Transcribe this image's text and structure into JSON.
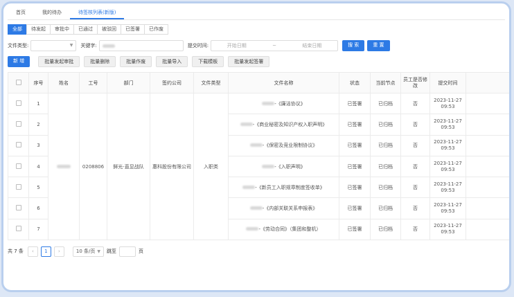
{
  "page_tabs": [
    "首页",
    "我的待办",
    "待签核列表(新版)"
  ],
  "status_tabs": [
    "全部",
    "待发起",
    "审批中",
    "已通过",
    "被驳回",
    "已签署",
    "已作废"
  ],
  "filters": {
    "doc_type_label": "文件类型:",
    "keyword_label": "关键字:",
    "time_label": "提交时间:",
    "start_placeholder": "开始日期",
    "range_sep": "~",
    "end_placeholder": "结束日期",
    "search_button": "搜 索",
    "reset_button": "重 置"
  },
  "actions": {
    "new_button": "新 增",
    "buttons": [
      "批量发起审批",
      "批量删除",
      "批量作废",
      "批量导入",
      "下载模板",
      "批量发起签署"
    ]
  },
  "table": {
    "headers": [
      "序号",
      "姓名",
      "工号",
      "部门",
      "签约公司",
      "文件类型",
      "文件名称",
      "状态",
      "当前节点",
      "员工是否修改",
      "提交时间"
    ],
    "shared": {
      "emp_no": "0208806",
      "dept": "鲜光-直显战队",
      "company": "惠科股份有限公司",
      "doc_type": "入职类"
    },
    "rows": [
      {
        "no": "1",
        "file": "-《廉洁协议》",
        "status": "已签署",
        "node": "已归档",
        "modified": "否",
        "date": "2023-11-27",
        "time": "09:53"
      },
      {
        "no": "2",
        "file": "-《商业秘密及知识产权入职声明》",
        "status": "已签署",
        "node": "已归档",
        "modified": "否",
        "date": "2023-11-27",
        "time": "09:53"
      },
      {
        "no": "3",
        "file": "-《保密及竞业限制协议》",
        "status": "已签署",
        "node": "已归档",
        "modified": "否",
        "date": "2023-11-27",
        "time": "09:53"
      },
      {
        "no": "4",
        "file": "-《入职声明》",
        "status": "已签署",
        "node": "已归档",
        "modified": "否",
        "date": "2023-11-27",
        "time": "09:53"
      },
      {
        "no": "5",
        "file": "-《新员工入职规章制度签收单》",
        "status": "已签署",
        "node": "已归档",
        "modified": "否",
        "date": "2023-11-27",
        "time": "09:53"
      },
      {
        "no": "6",
        "file": "-《内部关联关系申报表》",
        "status": "已签署",
        "node": "已归档",
        "modified": "否",
        "date": "2023-11-27",
        "time": "09:53"
      },
      {
        "no": "7",
        "file": "-《劳动合同》（集团和整机）",
        "status": "已签署",
        "node": "已归档",
        "modified": "否",
        "date": "2023-11-27",
        "time": "09:53"
      }
    ]
  },
  "pager": {
    "total": "共 7 条",
    "page": "1",
    "size": "10 条/页",
    "jump_label": "跳至",
    "page_label": "页"
  },
  "icons": {
    "prev": "chevron-left-icon",
    "next": "chevron-right-icon",
    "dropdown": "chevron-down-icon"
  },
  "colors": {
    "primary": "#2d7ae5",
    "frame": "#b9cfee"
  }
}
